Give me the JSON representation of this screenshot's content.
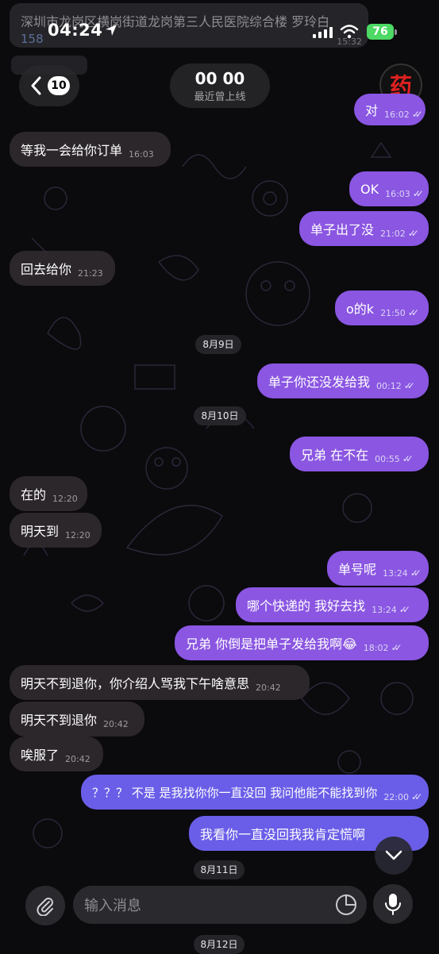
{
  "notification": {
    "text": "深圳市龙岗区横岗街道龙岗第三人民医院综合楼  罗玲白",
    "number_partial": "158",
    "time_partial": "15:32"
  },
  "status_bar": {
    "time": "04:24",
    "battery": "76"
  },
  "header": {
    "back_count": "10",
    "title": "00 00",
    "subtitle": "最近曾上线",
    "avatar_char": "药"
  },
  "messages": [
    {
      "dir": "out",
      "text": "对",
      "time": "16:02"
    },
    {
      "dir": "in",
      "text": "等我一会给你订单",
      "time": "16:03"
    },
    {
      "dir": "out",
      "text": "OK",
      "time": "16:03"
    },
    {
      "dir": "out",
      "text": "单子出了没",
      "time": "21:02"
    },
    {
      "dir": "in",
      "text": "回去给你",
      "time": "21:23"
    },
    {
      "dir": "out",
      "text": "o的k",
      "time": "21:50"
    },
    {
      "dir": "out",
      "text": "单子你还没发给我",
      "time": "00:12"
    },
    {
      "dir": "out",
      "text": "兄弟  在不在",
      "time": "00:55"
    },
    {
      "dir": "in",
      "text": "在的",
      "time": "12:20"
    },
    {
      "dir": "in",
      "text": "明天到",
      "time": "12:20"
    },
    {
      "dir": "out",
      "text": "单号呢",
      "time": "13:24"
    },
    {
      "dir": "out",
      "text": "哪个快递的  我好去找",
      "time": "13:24"
    },
    {
      "dir": "out",
      "text": "兄弟  你倒是把单子发给我啊😂",
      "time": "18:02"
    },
    {
      "dir": "in",
      "text": "明天不到退你，你介绍人骂我下午啥意思",
      "time": "20:42"
    },
    {
      "dir": "in",
      "text": "明天不到退你",
      "time": "20:42"
    },
    {
      "dir": "in",
      "text": "唉服了",
      "time": "20:42"
    },
    {
      "dir": "out",
      "text": "？？？ 不是  是我找你你一直没回  我问他能不能找到你",
      "time": "22:00"
    },
    {
      "dir": "out",
      "text": "我看你一直没回我我肯定慌啊",
      "time": ""
    }
  ],
  "dates": [
    "8月9日",
    "8月10日",
    "8月11日",
    "8月12日"
  ],
  "composer": {
    "placeholder": "输入消息"
  },
  "colors": {
    "outgoing": "#8a56e2",
    "outgoing_blue": "#6a5ee8",
    "incoming": "#302a2e",
    "background": "#0b0a0d"
  }
}
